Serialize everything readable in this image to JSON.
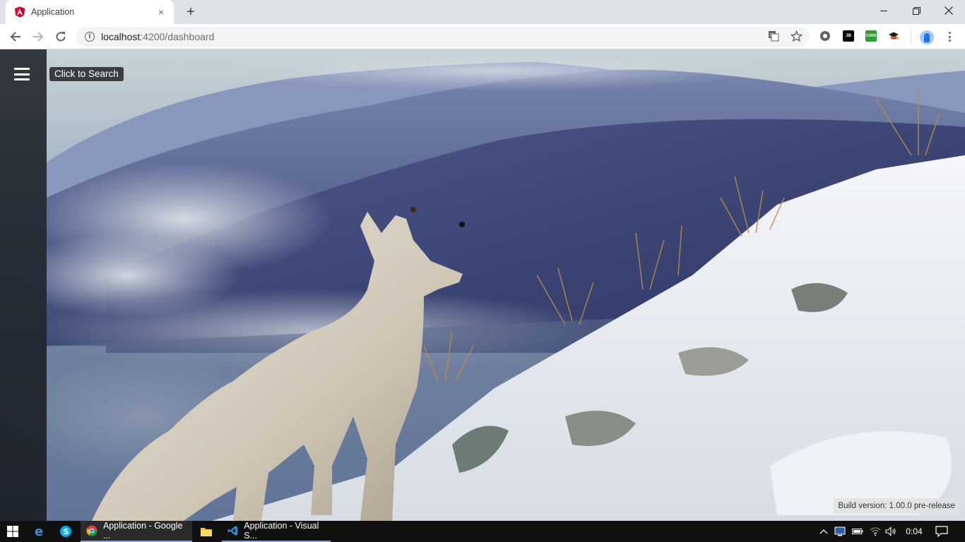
{
  "browser": {
    "tab_title": "Application",
    "tab_close": "×",
    "new_tab": "+",
    "url_host": "localhost",
    "url_path": ":4200/dashboard",
    "extensions": [
      "globe-extension",
      "jb-extension",
      "cors-extension",
      "graduation-extension"
    ],
    "ext_jb_label": "JB",
    "ext_cors_label": "CORS"
  },
  "page": {
    "search_tooltip": "Click to Search",
    "build_version": "Build version: 1.00.0 pre-release",
    "background": "arctic-fox-on-snowy-mountain"
  },
  "taskbar": {
    "tasks": [
      {
        "label": "Application - Google ...",
        "icon": "chrome-icon"
      },
      {
        "label": "Application - Visual S...",
        "icon": "vscode-icon"
      }
    ],
    "clock": "0:04"
  },
  "colors": {
    "tabstrip": "#dee1e6",
    "angular_red": "#dd0031",
    "sidebar": "#282c32",
    "taskbar": "#101010",
    "accent": "#7ea7d8"
  }
}
